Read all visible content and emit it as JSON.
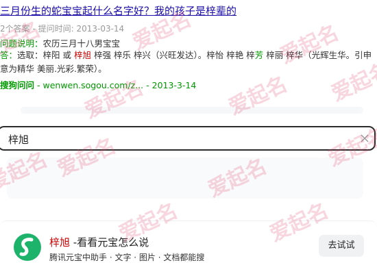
{
  "result": {
    "title": "三月份生的蛇宝宝起什么名字好？我的孩子是梓辈的",
    "meta": "2个答案 - 提问时间: 2013-03-14",
    "question_label": "问题说明：",
    "question_text": "农历三月十八男宝宝",
    "answer_label": "答：",
    "answer_prefix": "选取：",
    "answer_name1": "梓阳",
    "answer_or": "或",
    "answer_name2": "梓旭",
    "answer_rest1": "梓强 梓乐 梓兴（兴旺发达）。梓怡 梓艳 梓",
    "answer_green": "芳",
    "answer_rest2": "梓丽 梓华（光辉生华。引申意为精华 美丽.光彩.繁荣）。",
    "source_name": "搜狗问问",
    "source_url": "wenwen.sogou.com/z...",
    "source_date": "- 2013-3-14"
  },
  "search": {
    "value": "梓旭",
    "clear_icon": "close-icon"
  },
  "card": {
    "title_highlight": "梓旭",
    "title_rest": " -看看元宝怎么说",
    "subtitle": "腾讯元宝中助手 · 文字 · 图片 · 文档都能搜",
    "button": "去试试",
    "logo_color": "#1db36b"
  },
  "watermark": "爱起名",
  "colors": {
    "link": "#1a0dab",
    "green": "#009900",
    "highlight": "#cc0000",
    "watermark": "#e1466e"
  }
}
